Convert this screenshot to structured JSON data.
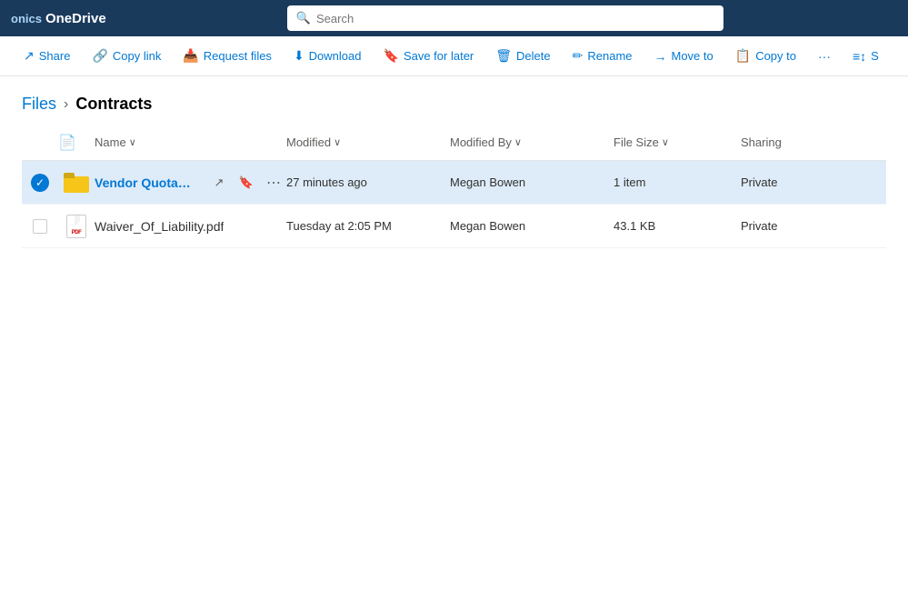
{
  "nav": {
    "brand_prefix": "onics",
    "brand_name": "OneDrive",
    "search_placeholder": "Search"
  },
  "toolbar": {
    "buttons": [
      {
        "id": "share",
        "icon": "↗",
        "label": "Share"
      },
      {
        "id": "copy-link",
        "icon": "🔗",
        "label": "Copy link"
      },
      {
        "id": "request-files",
        "icon": "📥",
        "label": "Request files"
      },
      {
        "id": "download",
        "icon": "⬇",
        "label": "Download"
      },
      {
        "id": "save-for-later",
        "icon": "🔖",
        "label": "Save for later"
      },
      {
        "id": "delete",
        "icon": "🗑",
        "label": "Delete"
      },
      {
        "id": "rename",
        "icon": "✏",
        "label": "Rename"
      },
      {
        "id": "move-to",
        "icon": "→",
        "label": "Move to"
      },
      {
        "id": "copy-to",
        "icon": "📋",
        "label": "Copy to"
      },
      {
        "id": "more",
        "icon": "···",
        "label": ""
      },
      {
        "id": "sort",
        "icon": "≡↕",
        "label": "S"
      }
    ]
  },
  "breadcrumb": {
    "parent": "Files",
    "separator": ">",
    "current": "Contracts"
  },
  "file_list": {
    "columns": [
      {
        "id": "check",
        "label": ""
      },
      {
        "id": "icon",
        "label": ""
      },
      {
        "id": "name",
        "label": "Name",
        "has_sort": true
      },
      {
        "id": "modified",
        "label": "Modified",
        "has_sort": true
      },
      {
        "id": "modified_by",
        "label": "Modified By",
        "has_sort": true
      },
      {
        "id": "file_size",
        "label": "File Size",
        "has_sort": true
      },
      {
        "id": "sharing",
        "label": "Sharing",
        "has_sort": false
      }
    ],
    "rows": [
      {
        "id": "vendor-quotations",
        "type": "folder",
        "name": "Vendor Quotations",
        "modified": "27 minutes ago",
        "modified_by": "Megan Bowen",
        "file_size": "1 item",
        "sharing": "Private",
        "selected": true
      },
      {
        "id": "waiver-of-liability",
        "type": "pdf",
        "name": "Waiver_Of_Liability.pdf",
        "modified": "Tuesday at 2:05 PM",
        "modified_by": "Megan Bowen",
        "file_size": "43.1 KB",
        "sharing": "Private",
        "selected": false
      }
    ]
  }
}
